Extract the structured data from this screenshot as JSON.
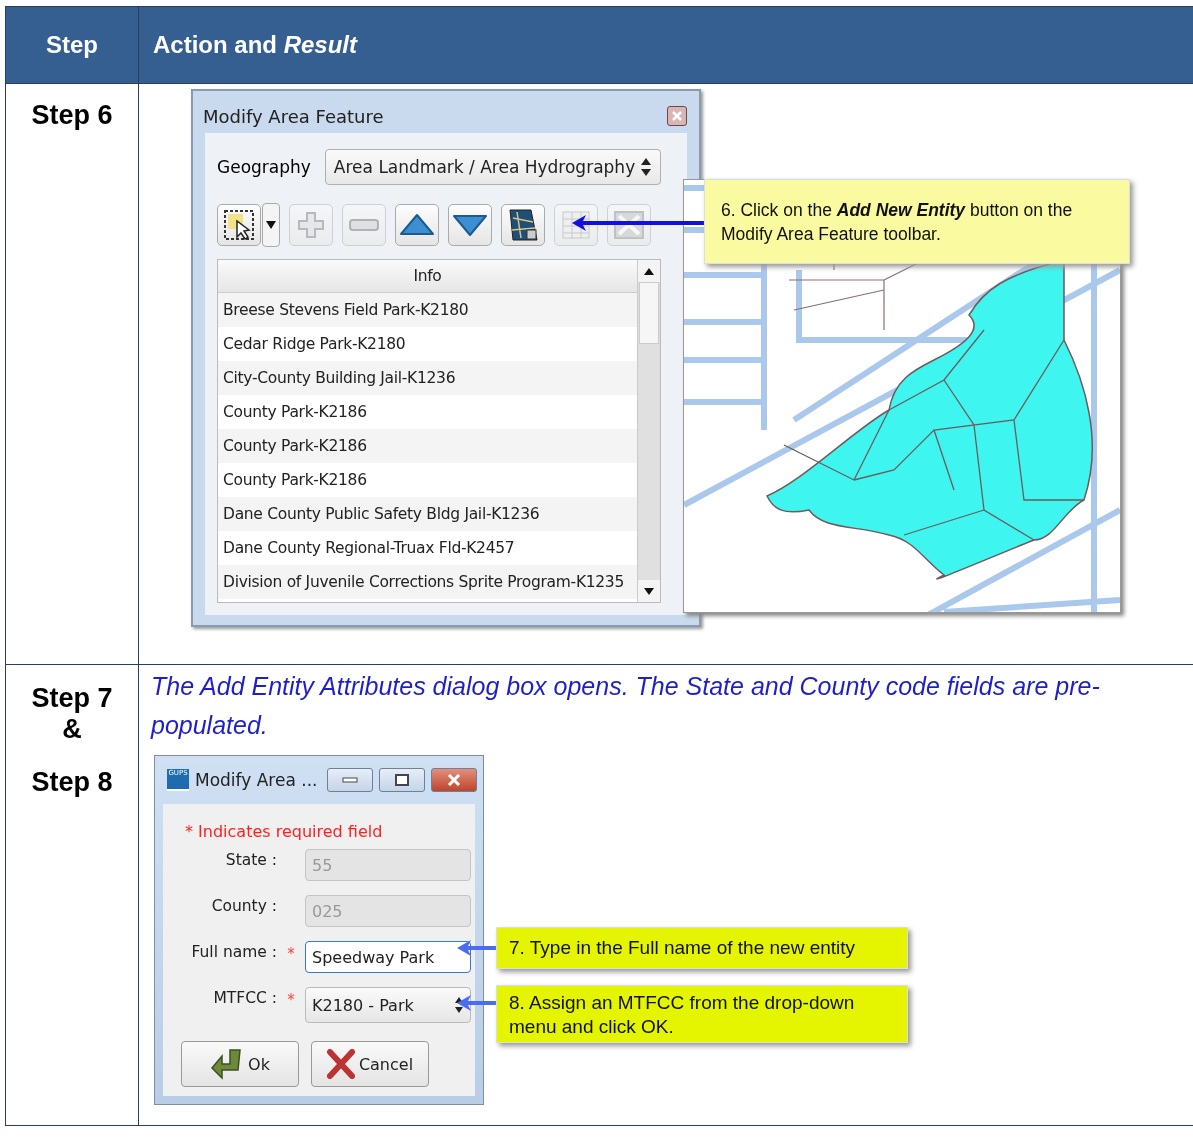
{
  "header": {
    "step": "Step",
    "action": "Action and *Result*"
  },
  "step6": {
    "step": "Step 6",
    "dialog": {
      "title": "Modify Area Feature",
      "geography_label": "Geography",
      "geography_value": "Area Landmark / Area Hydrography",
      "toolbar": [
        {
          "kind": "select",
          "disabled": false
        },
        {
          "kind": "add",
          "disabled": true
        },
        {
          "kind": "remove",
          "disabled": true
        },
        {
          "kind": "up",
          "disabled": false
        },
        {
          "kind": "down",
          "disabled": false
        },
        {
          "kind": "add-entity",
          "disabled": false
        },
        {
          "kind": "table",
          "disabled": true
        },
        {
          "kind": "close",
          "disabled": true
        }
      ],
      "list_header": "Info",
      "items": [
        "Breese Stevens Field Park-K2180",
        "Cedar Ridge Park-K2180",
        "City-County Building Jail-K1236",
        "County Park-K2186",
        "County Park-K2186",
        "County Park-K2186",
        "Dane County Public Safety Bldg Jail-K1236",
        "Dane County Regional-Truax Fld-K2457",
        "Division of Juvenile Corrections Sprite Program-K1235"
      ]
    },
    "callout": "6. Click on the **Add New Entity** button on the Modify Area Feature toolbar."
  },
  "step78": {
    "steps": [
      "Step 7",
      "&",
      "Step 8"
    ],
    "description": "The Add Entity Attributes dialog box opens. The State and County code fields are pre-populated.",
    "dialog": {
      "app_icon": "GUPS",
      "title": "Modify Area ...",
      "required_note": "* Indicates required field",
      "fields": [
        {
          "kind": "text",
          "label": "State :",
          "value": "55",
          "disabled": true
        },
        {
          "kind": "text",
          "label": "County :",
          "value": "025",
          "disabled": true
        },
        {
          "kind": "text",
          "label": "Full name :",
          "required_mark": "*",
          "value": "Speedway Park",
          "disabled": false
        },
        {
          "kind": "select",
          "label": "MTFCC :",
          "required_mark": "*",
          "value": "K2180 - Park",
          "disabled": false
        }
      ],
      "buttons": [
        {
          "kind": "ok",
          "label": "Ok"
        },
        {
          "kind": "cancel",
          "label": "Cancel"
        }
      ]
    },
    "callouts": [
      "7. Type in the Full name of the new entity",
      "8. Assign an MTFCC from the drop-down menu and click OK."
    ]
  }
}
